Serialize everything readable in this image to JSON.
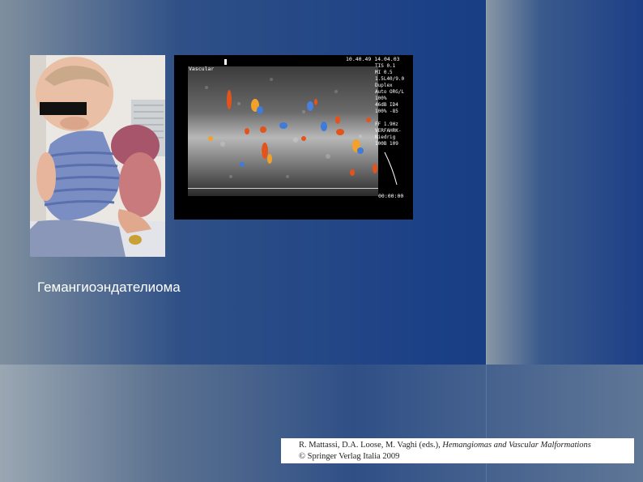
{
  "slide": {
    "caption": "Гемангиоэндателиома",
    "citation": {
      "line1_authors": "R. Mattassi, D.A. Loose, M. Vaghi (eds.),",
      "line1_title": "Hemangiomas and Vascular Malformations",
      "line2": "© Springer Verlag Italia 2009"
    },
    "ultrasound": {
      "top_text": "10.40.49 14.04.03",
      "mode_label": "Vascular",
      "right_panel": [
        "TIS 0.1",
        "MI 0.5",
        "1.5L40/9.0",
        "Duplex",
        "Auto ORG/L",
        "100%",
        "46dB  ID4",
        "100%  -85",
        "",
        "FF 1.9Hz",
        "VERFAHRK-",
        "Niedrig",
        "100B  109"
      ],
      "bottom_text": "00:00:00"
    },
    "colors": {
      "background_blue": "#1a3f85",
      "caption_text": "#ffffff",
      "citation_background": "#ffffff"
    }
  }
}
